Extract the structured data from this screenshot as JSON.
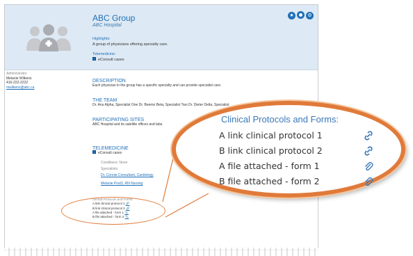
{
  "group": {
    "name": "ABC Group",
    "hospital": "ABC Hospital"
  },
  "header": {
    "highlights_label": "Highlights:",
    "highlights_text": "A group of physicians offering specialty care.",
    "telemedicine_label": "Telemedicine:",
    "telemedicine_option": "eConsult cases"
  },
  "admin": {
    "label": "Administrator",
    "name": "Melanie Wilkens",
    "phone": "416-222-2222",
    "email": "mwilkens@abc.ca"
  },
  "description": {
    "title": "DESCRIPTION",
    "text": "Each physician in the group has a specific specialty and can provide specialist care."
  },
  "team": {
    "title": "THE TEAM",
    "text": "Dr. Anu Alpha, Specialist One Dr. Beemo Beta, Specialist Two Dr. Dieter Delta, Specialist"
  },
  "sites": {
    "title": "PARTICIPATING SITES",
    "text": "ABC Hospital and its satellite offices and labs."
  },
  "telemedicine": {
    "title": "TELEMEDICINE",
    "option": "eConsult cases",
    "conditions": "Conditions: None",
    "specialists_label": "Specialists:",
    "specialist_1": "Dr. Connie Consultant, Cardiology",
    "specialist_2": "Melanie Post3, RN Nursing"
  },
  "protocols": {
    "title": "Clinical Protocols and Forms:",
    "items": [
      {
        "label": "A link clinical protocol 1",
        "icon": "link-icon"
      },
      {
        "label": "B link clinical protocol 2",
        "icon": "link-icon"
      },
      {
        "label": "A file attached - form 1",
        "icon": "paperclip-icon"
      },
      {
        "label": "B file attached - form  2",
        "icon": "paperclip-icon"
      }
    ]
  },
  "callout": {
    "title": "Clinical Protocols and Forms:",
    "items": [
      "A link clinical protocol 1",
      "B link clinical protocol 2",
      "A file attached - form 1",
      "B file attached - form  2"
    ]
  },
  "colors": {
    "accent": "#1f6fb8",
    "callout_border": "#e07a3a",
    "header_bg": "#dde9f4"
  }
}
